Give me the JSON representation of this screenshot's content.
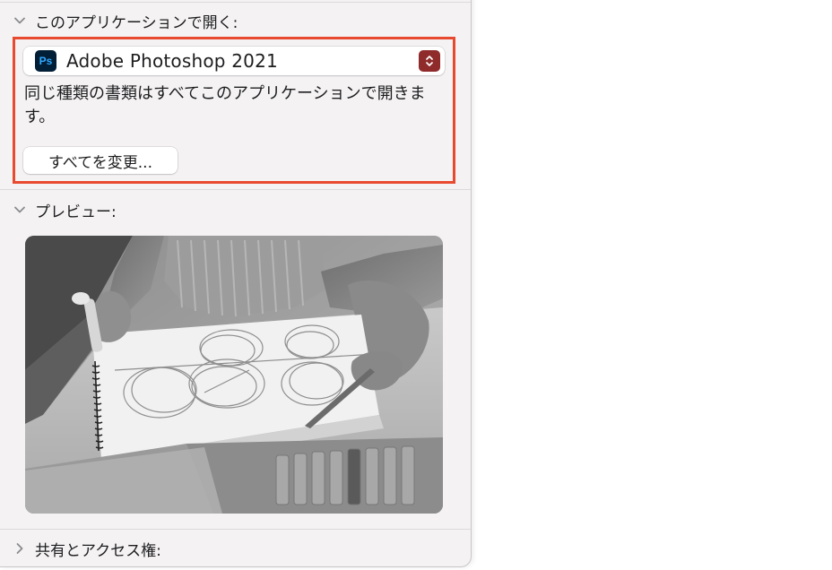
{
  "open_with": {
    "header": "このアプリケーションで開く:",
    "app_name": "Adobe Photoshop 2021",
    "app_icon_text": "Ps",
    "app_icon": "photoshop-icon",
    "description": "同じ種類の書類はすべてこのアプリケーションで開きます。",
    "change_all_label": "すべてを変更..."
  },
  "preview": {
    "header": "プレビュー:"
  },
  "sharing": {
    "header": "共有とアクセス権:"
  },
  "colors": {
    "highlight": "#e84a2f",
    "stepper": "#8f2b2b",
    "ps_icon_bg": "#001e36",
    "ps_icon_fg": "#31a8ff"
  }
}
